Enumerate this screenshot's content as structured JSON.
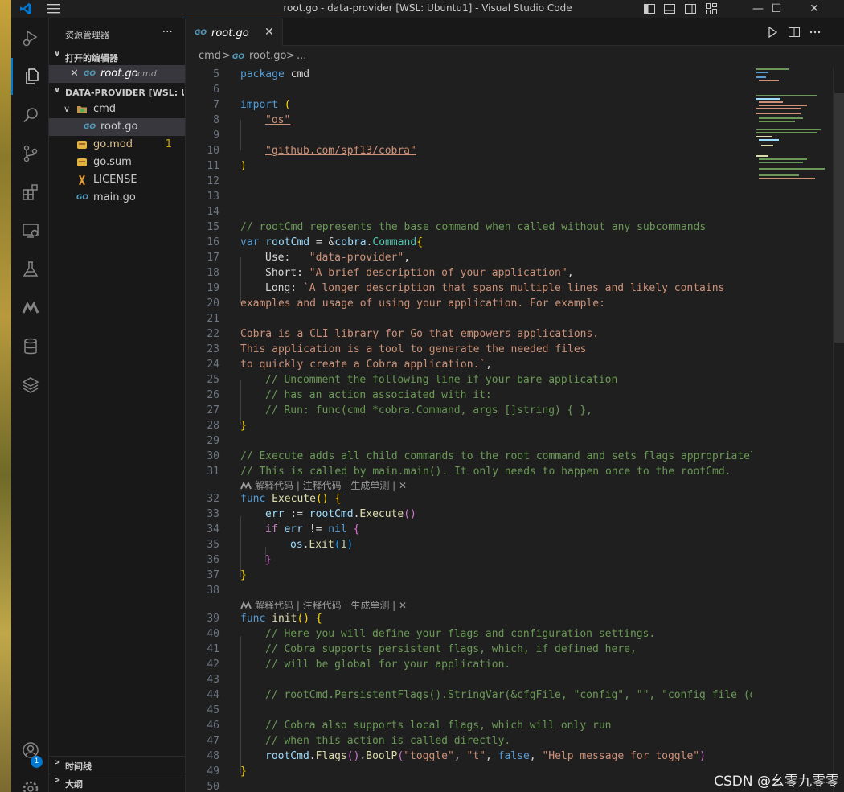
{
  "window": {
    "title": "root.go - data-provider [WSL: Ubuntu1] - Visual Studio Code",
    "min": "—",
    "max": "☐",
    "close": "✕"
  },
  "sidebar": {
    "title": "资源管理器",
    "more": "···",
    "open_editors_label": "打开的编辑器",
    "open_editors": [
      {
        "close": "✕",
        "name": "root.go",
        "dir": "cmd"
      }
    ],
    "workspace_label": "DATA-PROVIDER [WSL: UB...",
    "tree": [
      {
        "name": "cmd",
        "chev": "∨"
      },
      {
        "name": "root.go"
      },
      {
        "name": "go.mod",
        "badge": "1"
      },
      {
        "name": "go.sum"
      },
      {
        "name": "LICENSE"
      },
      {
        "name": "main.go"
      }
    ],
    "timeline_label": "时间线",
    "outline_label": "大纲"
  },
  "activity": {
    "account_badge": "1"
  },
  "tab": {
    "name": "root.go",
    "close": "✕"
  },
  "breadcrumb": {
    "folder": "cmd",
    "file": "root.go",
    "ellipsis": "..."
  },
  "codelens": {
    "text": "解释代码 | 注释代码 | 生成单测 | ✕"
  },
  "lines": [
    {
      "n": "5"
    },
    {
      "n": "6"
    },
    {
      "n": "7"
    },
    {
      "n": "8"
    },
    {
      "n": "9"
    },
    {
      "n": "10"
    },
    {
      "n": "11"
    },
    {
      "n": "12"
    },
    {
      "n": "13"
    },
    {
      "n": "14"
    },
    {
      "n": "15"
    },
    {
      "n": "16"
    },
    {
      "n": "17"
    },
    {
      "n": "18"
    },
    {
      "n": "19"
    },
    {
      "n": "20"
    },
    {
      "n": "21"
    },
    {
      "n": "22"
    },
    {
      "n": "23"
    },
    {
      "n": "24"
    },
    {
      "n": "25"
    },
    {
      "n": "26"
    },
    {
      "n": "27"
    },
    {
      "n": "28"
    },
    {
      "n": "29"
    },
    {
      "n": "30"
    },
    {
      "n": "31"
    },
    {
      "n": "32"
    },
    {
      "n": "33"
    },
    {
      "n": "34"
    },
    {
      "n": "35"
    },
    {
      "n": "36"
    },
    {
      "n": "37"
    },
    {
      "n": "38"
    },
    {
      "n": "39"
    },
    {
      "n": "40"
    },
    {
      "n": "41"
    },
    {
      "n": "42"
    },
    {
      "n": "43"
    },
    {
      "n": "44"
    },
    {
      "n": "45"
    },
    {
      "n": "46"
    },
    {
      "n": "47"
    },
    {
      "n": "48"
    },
    {
      "n": "49"
    },
    {
      "n": "50"
    }
  ],
  "code": {
    "l5": [
      "package",
      " cmd"
    ],
    "l7": [
      "import",
      " ("
    ],
    "l8": "\"os\"",
    "l10": "\"github.com/spf13/cobra\"",
    "l11": ")",
    "l15": "// rootCmd represents the base command when called without any subcommands",
    "l16": [
      "var",
      " rootCmd",
      " = &",
      "cobra",
      ".",
      "Command",
      "{"
    ],
    "l17": [
      "Use:   ",
      "\"data-provider\"",
      ","
    ],
    "l18": [
      "Short: ",
      "\"A brief description of your application\"",
      ","
    ],
    "l19": [
      "Long: ",
      "`A longer description that spans multiple lines and likely contains"
    ],
    "l20": "examples and usage of using your application. For example:",
    "l22": "Cobra is a CLI library for Go that empowers applications.",
    "l23": "This application is a tool to generate the needed files",
    "l24": [
      "to quickly create a Cobra application.`",
      ","
    ],
    "l25": "// Uncomment the following line if your bare application",
    "l26": "// has an action associated with it:",
    "l27": "// Run: func(cmd *cobra.Command, args []string) { },",
    "l28": "}",
    "l30": "// Execute adds all child commands to the root command and sets flags appropriately.",
    "l31": "// This is called by main.main(). It only needs to happen once to the rootCmd.",
    "l32": [
      "func",
      " Execute",
      "()",
      " {"
    ],
    "l33": [
      "err",
      " := ",
      "rootCmd",
      ".",
      "Execute",
      "()"
    ],
    "l34": [
      "if",
      " err",
      " != ",
      "nil",
      " {"
    ],
    "l35": [
      "os",
      ".",
      "Exit",
      "(",
      "1",
      ")"
    ],
    "l36": "}",
    "l37": "}",
    "l39": [
      "func",
      " init",
      "()",
      " {"
    ],
    "l40": "// Here you will define your flags and configuration settings.",
    "l41": "// Cobra supports persistent flags, which, if defined here,",
    "l42": "// will be global for your application.",
    "l44": "// rootCmd.PersistentFlags().StringVar(&cfgFile, \"config\", \"\", \"config file (default is $HOME/.data-provider.yaml)\")",
    "l46": "// Cobra also supports local flags, which will only run",
    "l47": "// when this action is called directly.",
    "l48": [
      "rootCmd",
      ".",
      "Flags",
      "()",
      ".",
      "BoolP",
      "(",
      "\"toggle\"",
      ", ",
      "\"t\"",
      ", ",
      "false",
      ", ",
      "\"Help message for toggle\"",
      ")"
    ],
    "l49": "}"
  },
  "watermark": "CSDN @幺零九零零"
}
